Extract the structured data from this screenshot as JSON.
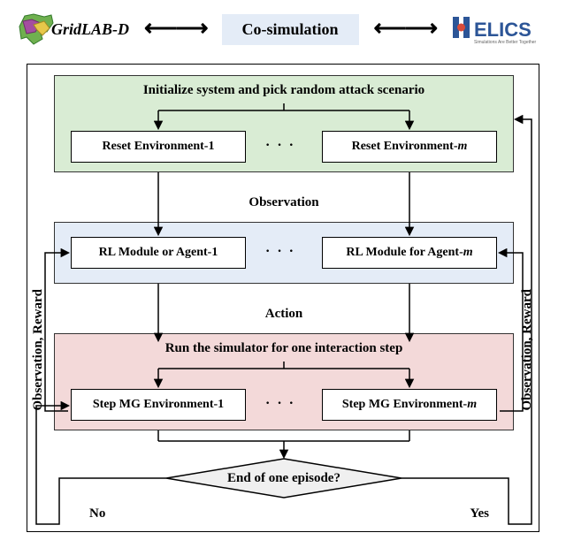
{
  "top": {
    "gridlab_brand": "GridLAB-D",
    "cosim": "Co-simulation",
    "helics_tag": "Simulations Are Better Together"
  },
  "blocks": {
    "green": {
      "title": "Initialize system and pick random attack scenario"
    },
    "env_left_prefix": "Reset Environment-",
    "env_left_suffix": "1",
    "env_right_prefix": "Reset Environment-",
    "env_right_suffix": "m",
    "dots": "· · ·",
    "rl_left_prefix": "RL Module or Agent-",
    "rl_left_suffix": "1",
    "rl_right_prefix": "RL Module for Agent-",
    "rl_right_suffix": "m",
    "red": {
      "title": "Run the simulator for one interaction step"
    },
    "step_left_prefix": "Step MG Environment-",
    "step_left_suffix": "1",
    "step_right_prefix": "Step MG Environment-",
    "step_right_suffix": "m"
  },
  "labels": {
    "observation": "Observation",
    "action": "Action",
    "side": "Observation, Reward",
    "decision": "End of one episode?",
    "no": "No",
    "yes": "Yes"
  }
}
